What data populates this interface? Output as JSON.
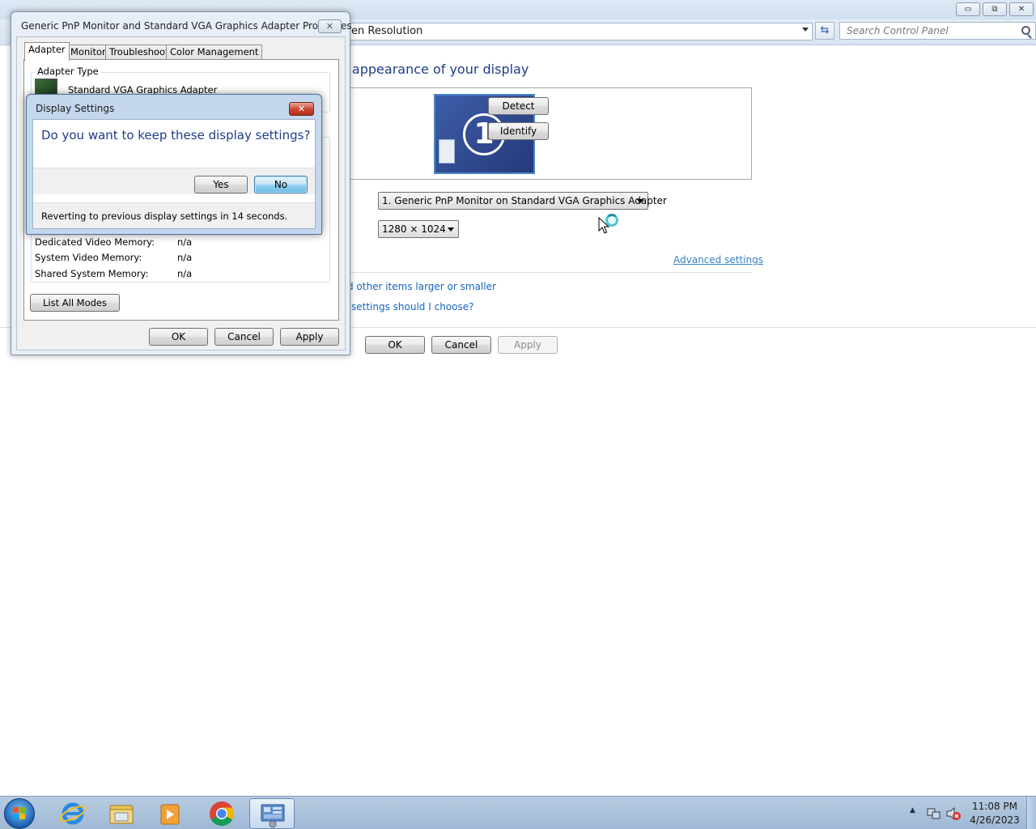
{
  "control_panel": {
    "address_text": "en Resolution",
    "search_placeholder": "Search Control Panel",
    "heading": "e appearance of your display",
    "monitor_number": "1",
    "detect_label": "Detect",
    "identify_label": "Identify",
    "display_select": "1. Generic PnP Monitor on Standard VGA Graphics Adapter",
    "resolution_select": "1280 × 1024",
    "advanced_link": "Advanced settings",
    "link_text_size": "d other items larger or smaller",
    "link_which_settings": "settings should I choose?",
    "ok_label": "OK",
    "cancel_label": "Cancel",
    "apply_label": "Apply",
    "caption_min": "▭",
    "caption_max": "⧉",
    "caption_close": "✕"
  },
  "properties_dialog": {
    "title": "Generic PnP Monitor and Standard VGA Graphics Adapter Properties",
    "close_label": "✕",
    "tabs": [
      {
        "label": "Adapter"
      },
      {
        "label": "Monitor"
      },
      {
        "label": "Troubleshoot"
      },
      {
        "label": "Color Management"
      }
    ],
    "adapter_type_label": "Adapter Type",
    "adapter_name": "Standard VGA Graphics Adapter",
    "memory_rows": [
      {
        "label": "Dedicated Video Memory:",
        "value": "n/a"
      },
      {
        "label": "System Video Memory:",
        "value": "n/a"
      },
      {
        "label": "Shared System Memory:",
        "value": "n/a"
      }
    ],
    "list_all_modes_label": "List All Modes",
    "ok_label": "OK",
    "cancel_label": "Cancel",
    "apply_label": "Apply"
  },
  "display_settings_dialog": {
    "title": "Display Settings",
    "close_label": "✕",
    "question": "Do you want to keep these display settings?",
    "yes_label": "Yes",
    "no_label": "No",
    "revert_message": "Reverting to previous display settings in 14 seconds."
  },
  "taskbar": {
    "time": "11:08 PM",
    "date": "4/26/2023",
    "tray_arrow": "▲"
  },
  "colors": {
    "heading_blue": "#1e3c87",
    "link_blue": "#1565c0",
    "close_red": "#c7442e"
  }
}
